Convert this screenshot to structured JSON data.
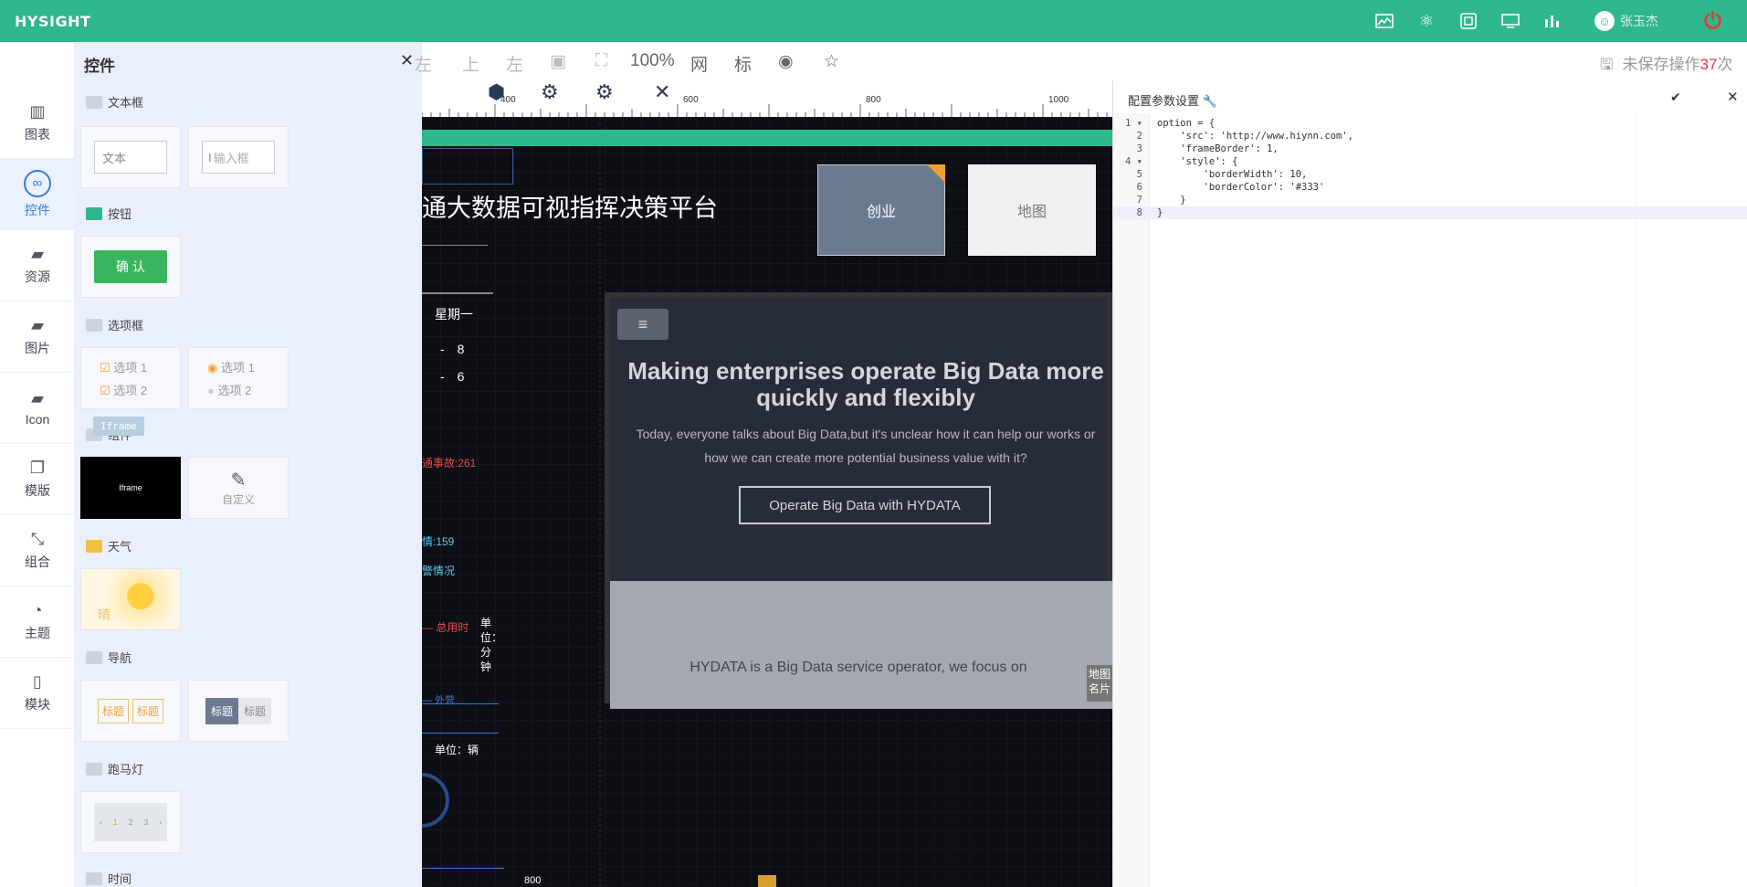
{
  "app": {
    "logo": "HYSIGHT",
    "user_name": "张玉杰",
    "brand_color": "#2fb78d"
  },
  "topbar_icons": [
    "area-chart-icon",
    "atom-icon",
    "share-icon",
    "monitor-icon",
    "bar-chart-icon"
  ],
  "leftnav": [
    {
      "label": "图表",
      "icon": "bar-chart-icon"
    },
    {
      "label": "控件",
      "icon": "link-icon",
      "active": true
    },
    {
      "label": "资源",
      "icon": "book-icon"
    },
    {
      "label": "图片",
      "icon": "book-icon"
    },
    {
      "label": "Icon",
      "icon": "book-icon"
    },
    {
      "label": "模版",
      "icon": "copy-icon"
    },
    {
      "label": "组合",
      "icon": "compress-icon"
    },
    {
      "label": "主题",
      "icon": "pie-chart-icon"
    },
    {
      "label": "模块",
      "icon": "file-icon"
    }
  ],
  "panel": {
    "title": "控件",
    "sections": {
      "textbox": "文本框",
      "button": "按钮",
      "option": "选项框",
      "component": "组件",
      "weather": "天气",
      "nav": "导航",
      "marquee": "跑马灯",
      "time": "时间"
    },
    "text_card": "文本",
    "input_card": "输入框",
    "confirm_button": "确 认",
    "options": [
      "选项 1",
      "选项 2"
    ],
    "iframe_tooltip": "Iframe",
    "iframe_card": "Iframe",
    "custom_card": "自定义",
    "weather_card": "晴",
    "nav_labels": [
      "标题",
      "标题"
    ],
    "marquee_nums": [
      "1",
      "2",
      "3"
    ]
  },
  "toolbar": {
    "zoom": "100%",
    "grid": "网",
    "ruler": "标",
    "align_top": "上",
    "align_left": "左",
    "align_left2": "左",
    "unsaved_prefix": "未保存操作",
    "unsaved_count": "37",
    "unsaved_suffix": "次"
  },
  "ruler": {
    "labels": [
      "400",
      "600",
      "800",
      "1000"
    ]
  },
  "canvas": {
    "headline": "通大数据可视指挥决策平台",
    "tab_active": "创业",
    "tab_inactive": "地图",
    "weekday": "星期一",
    "digits": [
      "8",
      "6"
    ],
    "accident": "通事故:261",
    "stat1": "情:159",
    "stat2": "警情况",
    "total_time": "总用时",
    "unit_minutes": "单位：分钟",
    "outside": "外营",
    "unit_vehicle": "单位：辆",
    "bottom_num": "800",
    "map_card": "地图名片",
    "iframe_heading": "Making enterprises operate Big Data more quickly and flexibly",
    "iframe_sub": "Today, everyone talks about Big Data,but it's unclear how it can help our works or how we can create more potential business value with it?",
    "iframe_button": "Operate Big Data with HYDATA",
    "iframe_footer": "HYDATA is a Big Data service operator, we focus on"
  },
  "config": {
    "title": "配置参数设置",
    "code": [
      "option = {",
      "    'src': 'http://www.hiynn.com',",
      "    'frameBorder': 1,",
      "    'style': {",
      "        'borderWidth': 10,",
      "        'borderColor': '#333'",
      "    }",
      "}"
    ]
  }
}
